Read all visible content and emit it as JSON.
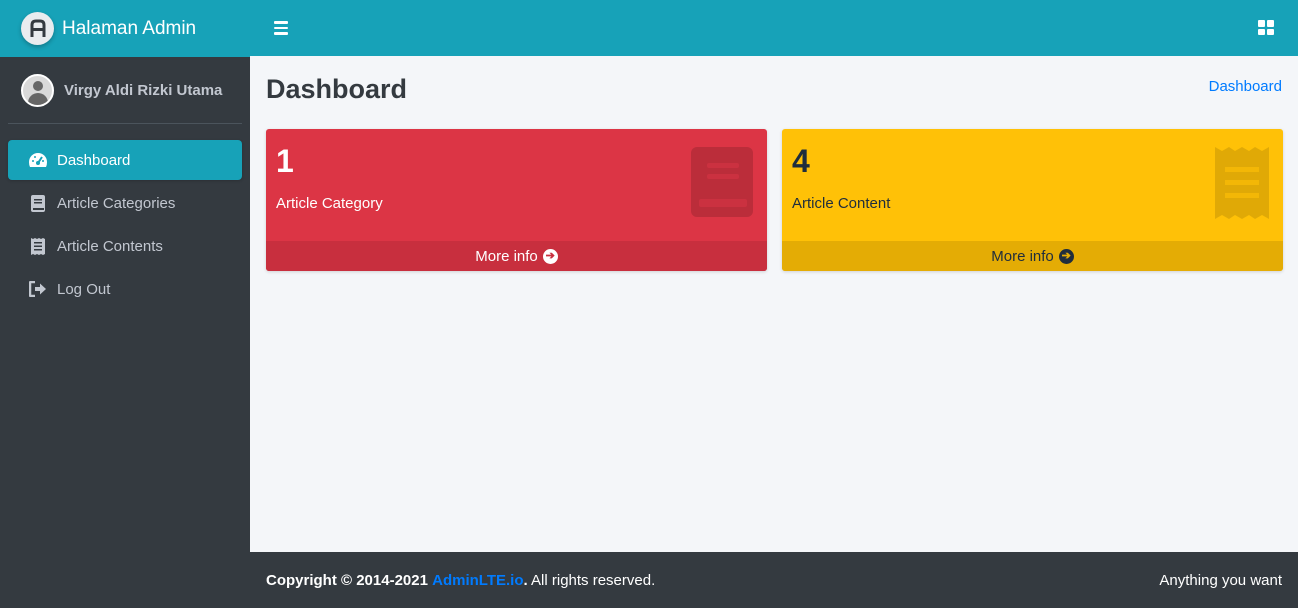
{
  "brand": {
    "name": "Halaman Admin",
    "logo_letter": "A"
  },
  "user": {
    "name": "Virgy Aldi Rizki Utama"
  },
  "nav": [
    {
      "label": "Dashboard",
      "icon": "tachometer-icon",
      "active": true
    },
    {
      "label": "Article Categories",
      "icon": "book-icon",
      "active": false
    },
    {
      "label": "Article Contents",
      "icon": "receipt-icon",
      "active": false
    },
    {
      "label": "Log Out",
      "icon": "sign-out-icon",
      "active": false
    }
  ],
  "page": {
    "title": "Dashboard",
    "breadcrumb": "Dashboard"
  },
  "cards": [
    {
      "value": "1",
      "label": "Article Category",
      "more": "More info",
      "color": "#dc3545",
      "icon": "book-icon"
    },
    {
      "value": "4",
      "label": "Article Content",
      "more": "More info",
      "color": "#ffc107",
      "icon": "receipt-icon"
    }
  ],
  "footer": {
    "copyright": "Copyright © 2014-2021",
    "link": "AdminLTE.io",
    "suffix": ". All rights reserved.",
    "right": "Anything you want"
  },
  "colors": {
    "primary": "#17a2b8",
    "sidebar": "#343a40",
    "link": "#007bff"
  }
}
